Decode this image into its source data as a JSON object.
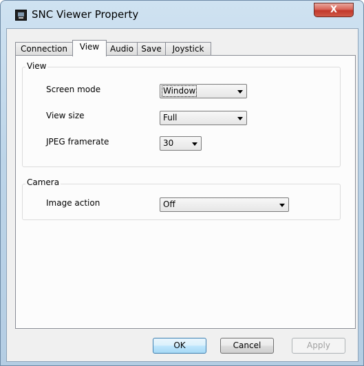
{
  "window": {
    "title": "SNC Viewer Property",
    "close_glyph": "X"
  },
  "tabs": [
    {
      "label": "Connection",
      "active": false
    },
    {
      "label": "View",
      "active": true
    },
    {
      "label": "Audio",
      "active": false
    },
    {
      "label": "Save",
      "active": false
    },
    {
      "label": "Joystick",
      "active": false
    }
  ],
  "view_group": {
    "title": "View",
    "screen_mode": {
      "label": "Screen mode",
      "value": "Window"
    },
    "view_size": {
      "label": "View size",
      "value": "Full"
    },
    "jpeg_framerate": {
      "label": "JPEG framerate",
      "value": "30"
    }
  },
  "camera_group": {
    "title": "Camera",
    "image_action": {
      "label": "Image action",
      "value": "Off"
    }
  },
  "buttons": {
    "ok": "OK",
    "cancel": "Cancel",
    "apply": "Apply"
  },
  "colors": {
    "frame": "#bcd4e8",
    "close_button": "#c2382b",
    "default_button_border": "#3c7fb1"
  }
}
